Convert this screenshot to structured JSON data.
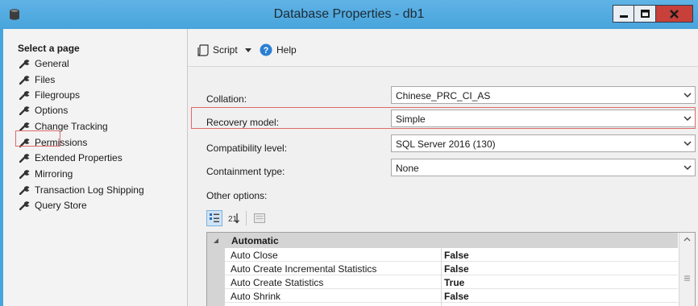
{
  "window": {
    "title": "Database Properties - db1"
  },
  "sidebar": {
    "heading": "Select a page",
    "items": [
      {
        "label": "General"
      },
      {
        "label": "Files"
      },
      {
        "label": "Filegroups"
      },
      {
        "label": "Options"
      },
      {
        "label": "Change Tracking"
      },
      {
        "label": "Permissions"
      },
      {
        "label": "Extended Properties"
      },
      {
        "label": "Mirroring"
      },
      {
        "label": "Transaction Log Shipping"
      },
      {
        "label": "Query Store"
      }
    ],
    "selected": "Options"
  },
  "toolbar": {
    "script_label": "Script",
    "help_label": "Help"
  },
  "fields": [
    {
      "label": "Collation:",
      "value": "Chinese_PRC_CI_AS"
    },
    {
      "label": "Recovery model:",
      "value": "Simple"
    },
    {
      "label": "Compatibility level:",
      "value": "SQL Server 2016 (130)"
    },
    {
      "label": "Containment type:",
      "value": "None"
    }
  ],
  "other_options": {
    "label": "Other options:",
    "category": "Automatic",
    "rows": [
      {
        "name": "Auto Close",
        "value": "False"
      },
      {
        "name": "Auto Create Incremental Statistics",
        "value": "False"
      },
      {
        "name": "Auto Create Statistics",
        "value": "True"
      },
      {
        "name": "Auto Shrink",
        "value": "False"
      }
    ]
  },
  "colors": {
    "titlebar": "#48a4dc",
    "close_button": "#c7403a",
    "highlight_box": "#e06a6a"
  }
}
